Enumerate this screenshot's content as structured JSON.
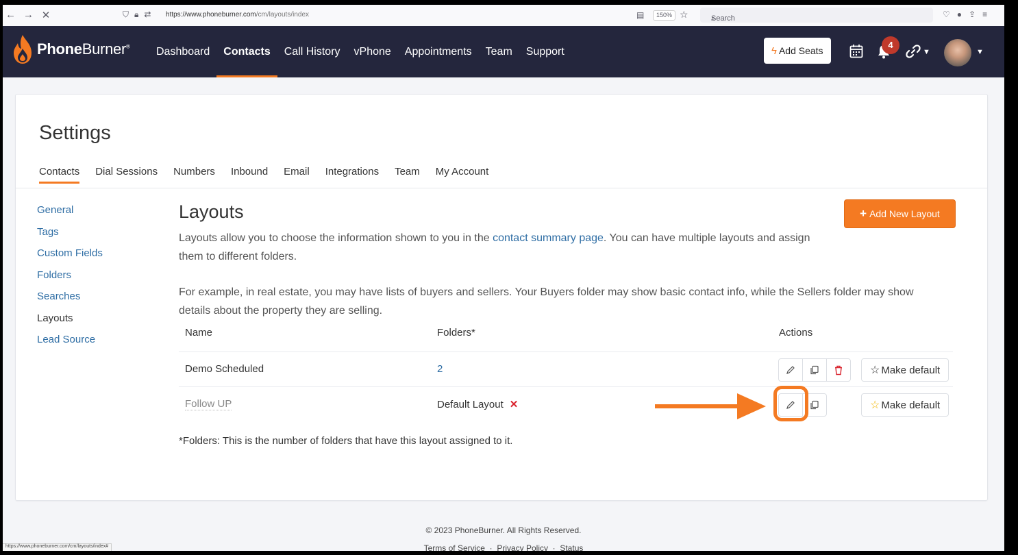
{
  "browser": {
    "url_host": "https://www.phoneburner.com",
    "url_path": "/cm/layouts/index",
    "zoom": "150%",
    "search_placeholder": "Search",
    "status_url": "https://www.phoneburner.com/cm/layouts/index#"
  },
  "header": {
    "brand_bold": "Phone",
    "brand_light": "Burner",
    "brand_mark": "®",
    "nav": [
      "Dashboard",
      "Contacts",
      "Call History",
      "vPhone",
      "Appointments",
      "Team",
      "Support"
    ],
    "active_nav": "Contacts",
    "add_seats": "Add Seats",
    "notification_count": "4"
  },
  "settings": {
    "title": "Settings",
    "tabs": [
      "Contacts",
      "Dial Sessions",
      "Numbers",
      "Inbound",
      "Email",
      "Integrations",
      "Team",
      "My Account"
    ],
    "sidebar": [
      "General",
      "Tags",
      "Custom Fields",
      "Folders",
      "Searches",
      "Layouts",
      "Lead Source"
    ]
  },
  "layouts": {
    "title": "Layouts",
    "add_button": "Add New Layout",
    "desc_pre": "Layouts allow you to choose the information shown to you in the ",
    "desc_link": "contact summary page",
    "desc_post": ". You can have multiple layouts and assign them to different folders.",
    "desc2": "For example, in real estate, you may have lists of buyers and sellers. Your Buyers folder may show basic contact info, while the Sellers folder may show details about the property they are selling.",
    "columns": {
      "name": "Name",
      "folders": "Folders*",
      "actions": "Actions"
    },
    "rows": [
      {
        "name": "Demo Scheduled",
        "folders": "2",
        "make_default": "Make default"
      },
      {
        "name": "Follow UP",
        "folders": "Default Layout",
        "make_default": "Make default"
      }
    ],
    "footnote": "*Folders: This is the number of folders that have this layout assigned to it."
  },
  "footer": {
    "copyright": "© 2023 PhoneBurner. All Rights Reserved.",
    "links": [
      "Terms of Service",
      "Privacy Policy",
      "Status"
    ]
  },
  "colors": {
    "accent": "#f47a22",
    "navbar": "#24263d",
    "link": "#2e6da4",
    "danger": "#d9232d"
  }
}
